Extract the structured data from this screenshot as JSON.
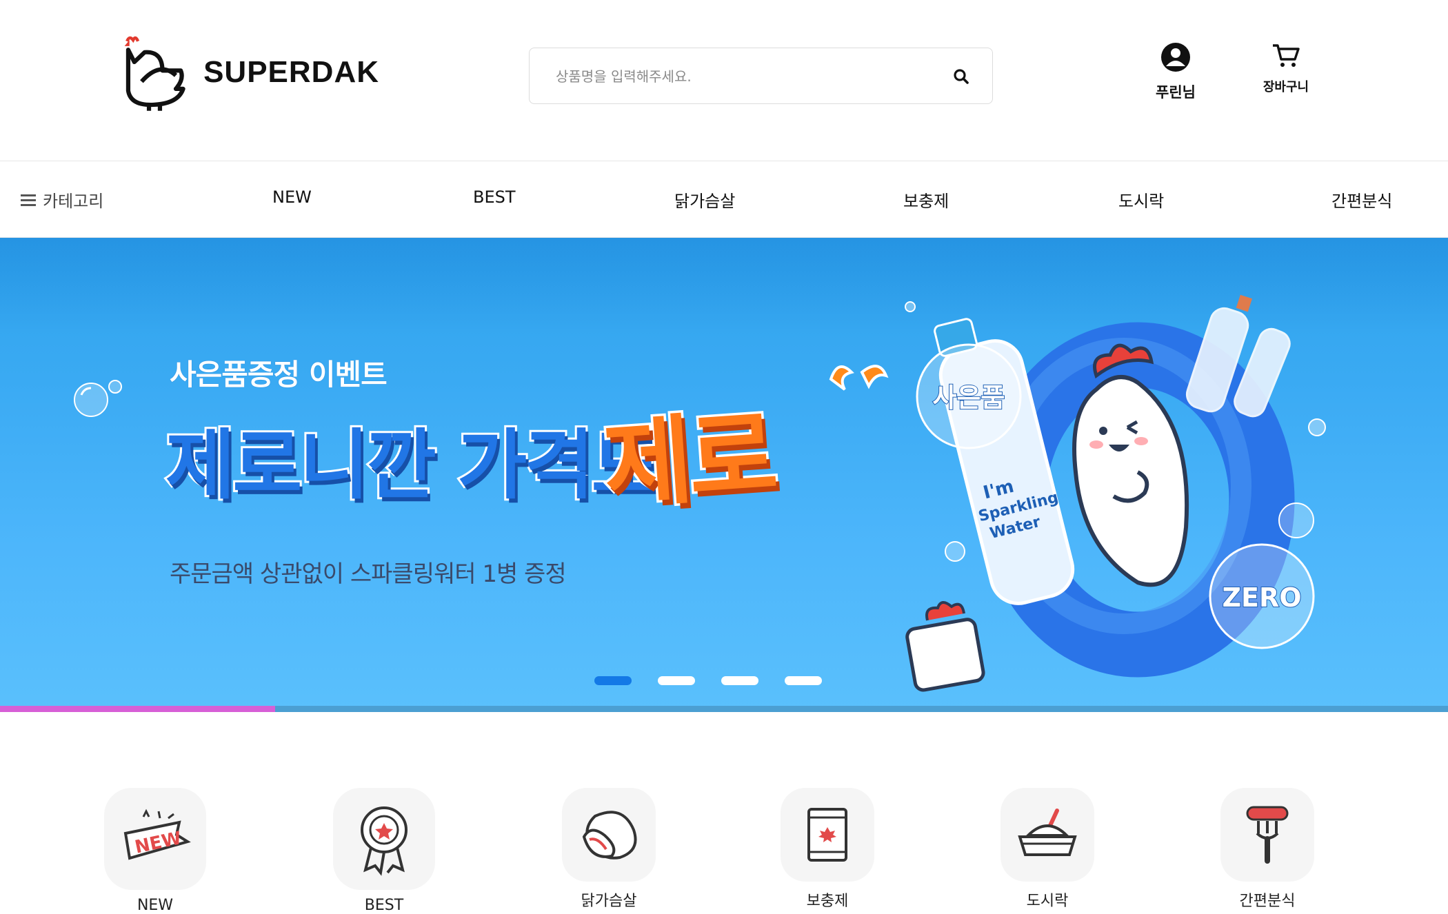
{
  "header": {
    "brand": "SUPERDAK",
    "search_placeholder": "상품명을 입력해주세요.",
    "user_label": "푸린님",
    "cart_label": "장바구니"
  },
  "nav": {
    "category_label": "카테고리",
    "items": [
      "NEW",
      "BEST",
      "닭가슴살",
      "보충제",
      "도시락",
      "간편분식"
    ]
  },
  "banner": {
    "small_title": "사은품증정 이벤트",
    "big_title": "제로니깐 가격도",
    "highlight": "제로",
    "subtitle": "주문금액 상관없이 스파클링워터 1병 증정",
    "badge_gift": "사은품",
    "badge_zero": "ZERO",
    "bottle_label": "I'm Sparkling Water",
    "slide_count": 4,
    "active_slide": 1,
    "progress_fraction": 0.19
  },
  "categories": [
    {
      "label": "NEW",
      "icon": "new-tag-icon"
    },
    {
      "label": "BEST",
      "icon": "badge-icon"
    },
    {
      "label": "닭가슴살",
      "icon": "chicken-breast-icon"
    },
    {
      "label": "보충제",
      "icon": "supplement-pack-icon"
    },
    {
      "label": "도시락",
      "icon": "lunchbox-icon"
    },
    {
      "label": "간편분식",
      "icon": "sausage-fork-icon"
    }
  ],
  "colors": {
    "banner_blue": "#3aaaf3",
    "title_blue": "#2176e6",
    "highlight_orange": "#ff7a1a",
    "active_dot": "#1479e6",
    "progress": "#d75fd6",
    "accent_red": "#e24a4a"
  }
}
